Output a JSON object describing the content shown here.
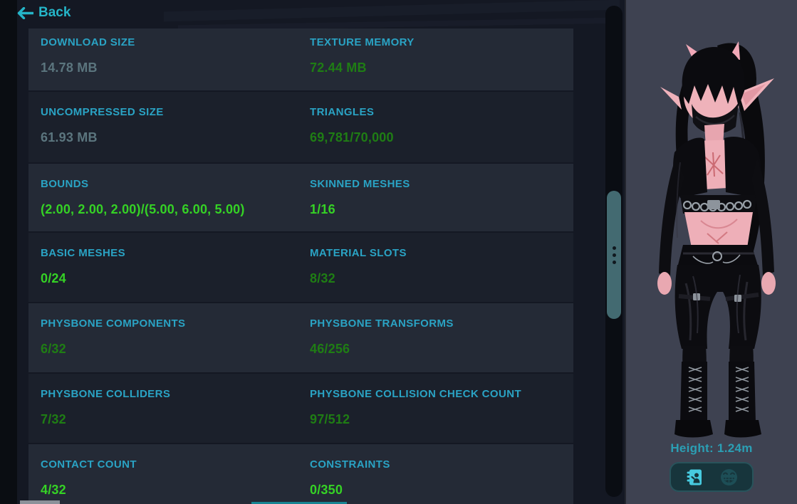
{
  "header": {
    "back_label": "Back"
  },
  "stats": [
    {
      "left": {
        "label": "DOWNLOAD SIZE",
        "value": "14.78 MB",
        "tone": "muted"
      },
      "right": {
        "label": "TEXTURE MEMORY",
        "value": "72.44 MB",
        "tone": "green"
      }
    },
    {
      "left": {
        "label": "UNCOMPRESSED SIZE",
        "value": "61.93 MB",
        "tone": "muted"
      },
      "right": {
        "label": "TRIANGLES",
        "value": "69,781/70,000",
        "tone": "green"
      }
    },
    {
      "left": {
        "label": "BOUNDS",
        "value": "(2.00, 2.00, 2.00)/(5.00, 6.00, 5.00)",
        "tone": "lime"
      },
      "right": {
        "label": "SKINNED MESHES",
        "value": "1/16",
        "tone": "lime"
      }
    },
    {
      "left": {
        "label": "BASIC MESHES",
        "value": "0/24",
        "tone": "lime"
      },
      "right": {
        "label": "MATERIAL SLOTS",
        "value": "8/32",
        "tone": "green"
      }
    },
    {
      "left": {
        "label": "PHYSBONE COMPONENTS",
        "value": "6/32",
        "tone": "green"
      },
      "right": {
        "label": "PHYSBONE TRANSFORMS",
        "value": "46/256",
        "tone": "green"
      }
    },
    {
      "left": {
        "label": "PHYSBONE COLLIDERS",
        "value": "7/32",
        "tone": "green"
      },
      "right": {
        "label": "PHYSBONE COLLISION CHECK COUNT",
        "value": "97/512",
        "tone": "green"
      }
    },
    {
      "left": {
        "label": "CONTACT COUNT",
        "value": "4/32",
        "tone": "lime"
      },
      "right": {
        "label": "CONSTRAINTS",
        "value": "0/350",
        "tone": "lime"
      }
    }
  ],
  "avatar_panel": {
    "height_label": "Height: 1.24m",
    "icons": [
      {
        "name": "avatar-stats-book-icon"
      },
      {
        "name": "expressions-face-icon"
      }
    ]
  },
  "colors": {
    "label_teal": "#2aa3c4",
    "back_teal": "#25b5c8",
    "value_muted": "#5b757e",
    "value_green": "#1f7d14",
    "value_lime": "#35d225",
    "row_light": "#242a36",
    "row_dark": "#1b202b",
    "panel_bg": "#3e4251",
    "scroll_thumb": "#436a71",
    "icon_cyan": "#47cadf"
  }
}
